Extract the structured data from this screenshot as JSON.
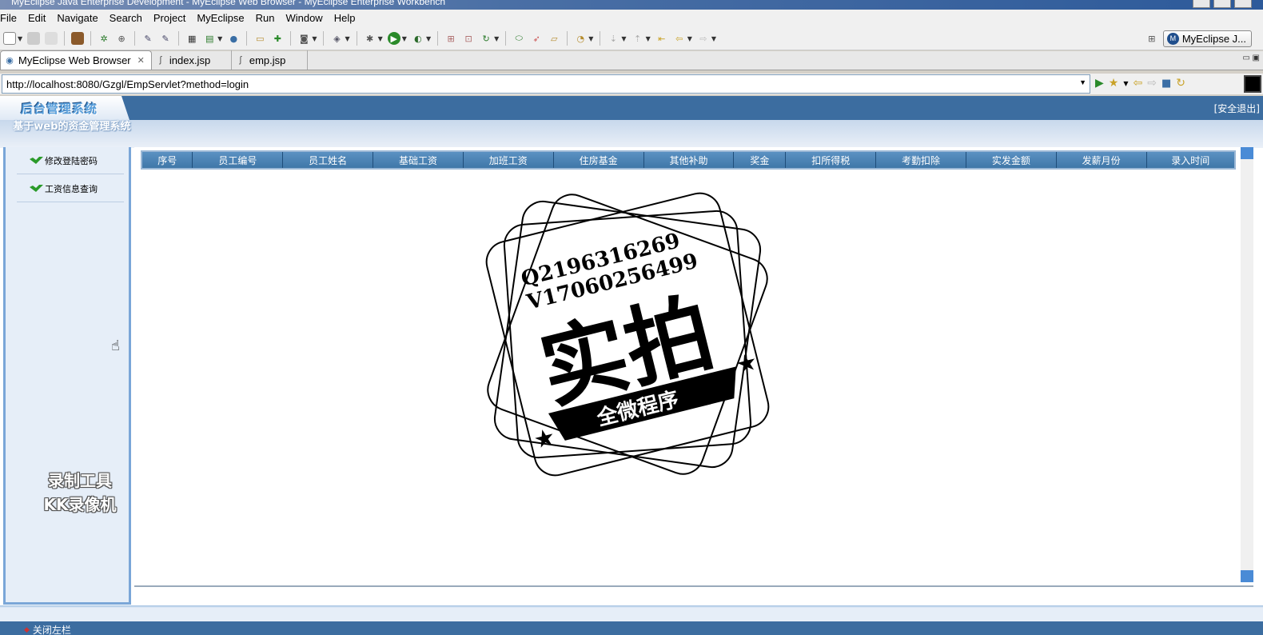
{
  "window": {
    "title": "MyEclipse Java Enterprise Development - MyEclipse Web Browser - MyEclipse Enterprise Workbench"
  },
  "menu": [
    "File",
    "Edit",
    "Navigate",
    "Search",
    "Project",
    "MyEclipse",
    "Run",
    "Window",
    "Help"
  ],
  "perspective_label": "MyEclipse J...",
  "tabs": [
    {
      "label": "MyEclipse Web Browser",
      "icon": "globe-icon",
      "active": true
    },
    {
      "label": "index.jsp",
      "icon": "jsp-file-icon",
      "active": false
    },
    {
      "label": "emp.jsp",
      "icon": "jsp-file-icon",
      "active": false
    }
  ],
  "address": {
    "url": "http://localhost:8080/Gzgl/EmpServlet?method=login"
  },
  "app": {
    "header_title": "后台管理系统",
    "subtitle": "基于web的资金管理系统",
    "safe_exit": "[安全退出]",
    "sidebar_items": [
      "修改登陆密码",
      "工资信息查询"
    ],
    "table_headers": [
      "序号",
      "员工编号",
      "员工姓名",
      "基础工资",
      "加班工资",
      "住房基金",
      "其他补助",
      "奖金",
      "扣所得税",
      "考勤扣除",
      "实发金额",
      "发薪月份",
      "录入时间"
    ],
    "footer_link": "关闭左栏"
  },
  "watermark": {
    "tool_line1": "录制工具",
    "tool_line2": "KK录像机",
    "stamp_line1": "Q2196316269",
    "stamp_line2": "V17060256499",
    "stamp_big": "实拍",
    "stamp_banner": "全微程序"
  },
  "colors": {
    "header_blue": "#3c6da0",
    "sidebar_bg": "#e6eef8",
    "table_header": "#3f77a8"
  }
}
